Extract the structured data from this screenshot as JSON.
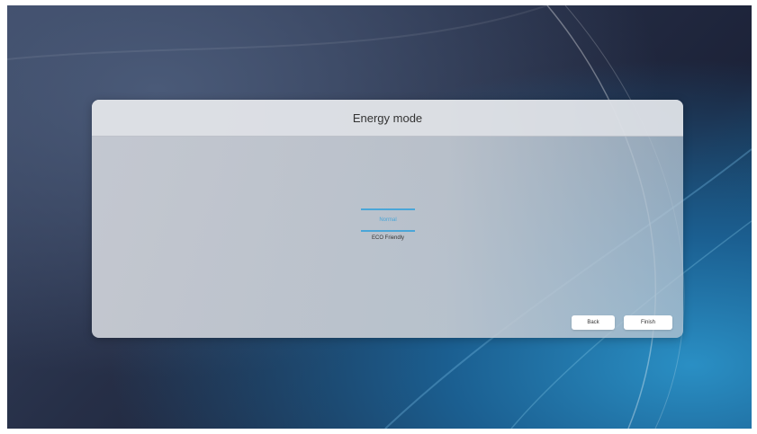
{
  "dialog": {
    "title": "Energy mode",
    "options": [
      {
        "label": "Normal",
        "selected": true
      },
      {
        "label": "ECO Friendly",
        "selected": false
      }
    ],
    "back_label": "Back",
    "finish_label": "Finish"
  },
  "colors": {
    "accent": "#4aa6d8",
    "background_dark": "#1c2238",
    "background_blue": "#2a8fc4"
  }
}
